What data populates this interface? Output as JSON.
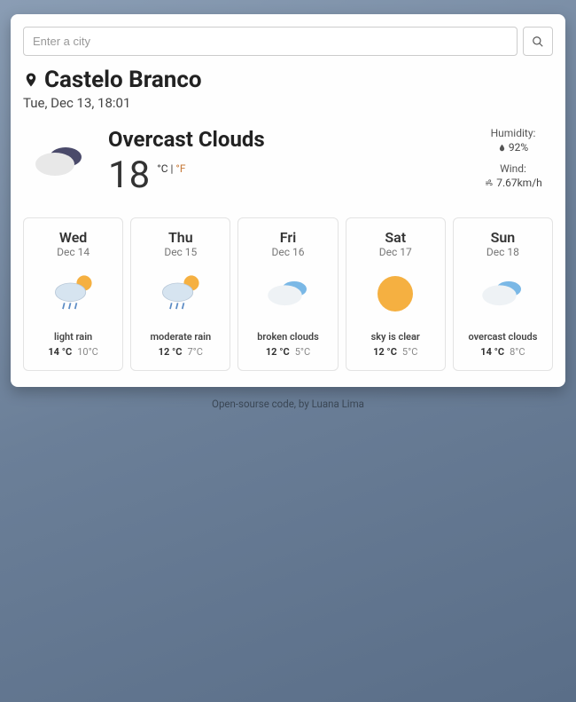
{
  "search": {
    "placeholder": "Enter a city"
  },
  "location": {
    "city": "Castelo Branco",
    "datetime": "Tue, Dec 13, 18:01"
  },
  "current": {
    "description": "Overcast Clouds",
    "temp": "18",
    "unit_c": "°C",
    "sep": " | ",
    "unit_f": "°F",
    "icon": "overcast"
  },
  "extras": {
    "humidity_label": "Humidity:",
    "humidity_value": "92%",
    "wind_label": "Wind:",
    "wind_value": "7.67km/h"
  },
  "forecast": [
    {
      "day": "Wed",
      "date": "Dec 14",
      "icon": "rain-sun",
      "desc": "light rain",
      "hi": "14 °C",
      "lo": "10°C"
    },
    {
      "day": "Thu",
      "date": "Dec 15",
      "icon": "rain-sun",
      "desc": "moderate rain",
      "hi": "12 °C",
      "lo": "7°C"
    },
    {
      "day": "Fri",
      "date": "Dec 16",
      "icon": "clouds",
      "desc": "broken clouds",
      "hi": "12 °C",
      "lo": "5°C"
    },
    {
      "day": "Sat",
      "date": "Dec 17",
      "icon": "clear",
      "desc": "sky is clear",
      "hi": "12 °C",
      "lo": "5°C"
    },
    {
      "day": "Sun",
      "date": "Dec 18",
      "icon": "clouds",
      "desc": "overcast clouds",
      "hi": "14 °C",
      "lo": "8°C"
    }
  ],
  "footer": "Open-sourse code, by Luana Lima"
}
